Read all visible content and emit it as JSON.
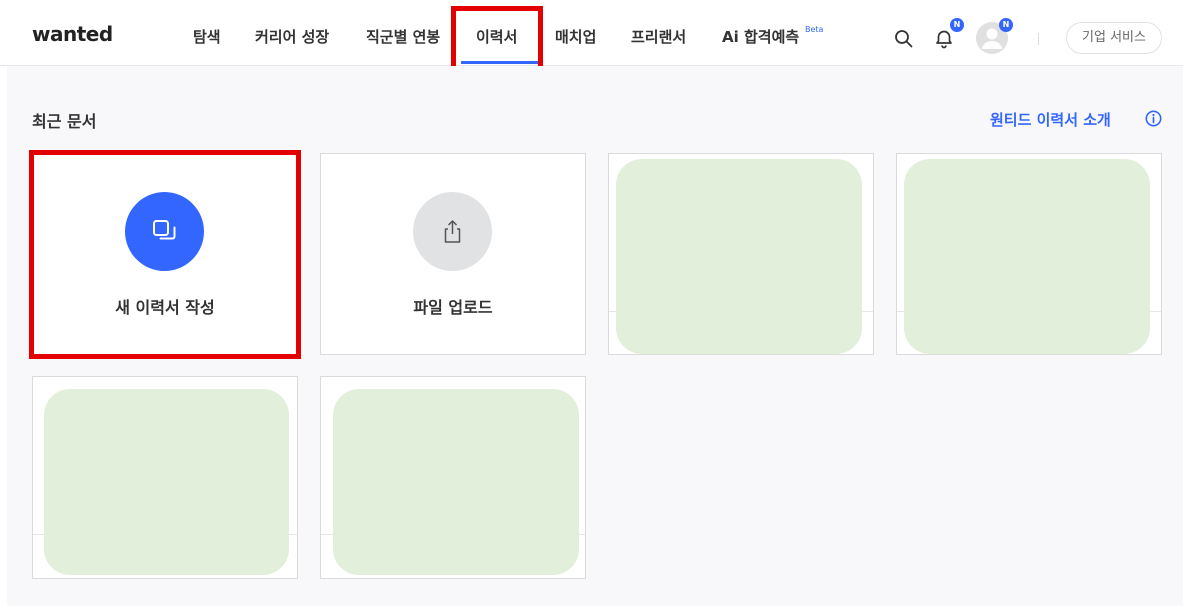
{
  "brand": {
    "logo_text": "wanted"
  },
  "nav": {
    "items": [
      {
        "label": "탐색"
      },
      {
        "label": "커리어 성장"
      },
      {
        "label": "직군별 연봉"
      },
      {
        "label": "이력서",
        "active": true
      },
      {
        "label": "매치업"
      },
      {
        "label": "프리랜서"
      },
      {
        "label": "Ai 합격예측",
        "badge": "Beta"
      }
    ]
  },
  "header_actions": {
    "search_icon": "search-icon",
    "notification_icon": "bell-icon",
    "notification_badge": "N",
    "profile_icon": "avatar",
    "profile_badge": "N",
    "corp_service_label": "기업 서비스"
  },
  "main": {
    "section_title": "최근 문서",
    "intro_link": "원티드 이력서 소개",
    "intro_icon": "info-icon",
    "cards": {
      "new_resume": {
        "label": "새 이력서 작성",
        "icon": "copy-icon"
      },
      "upload": {
        "label": "파일 업로드",
        "icon": "upload-icon"
      }
    },
    "document_count": 4
  },
  "colors": {
    "accent": "#3366ff",
    "highlight": "#e30000",
    "doc_placeholder": "#e2efda",
    "page_bg": "#f8f8fa",
    "upload_circle": "#e1e2e3"
  }
}
